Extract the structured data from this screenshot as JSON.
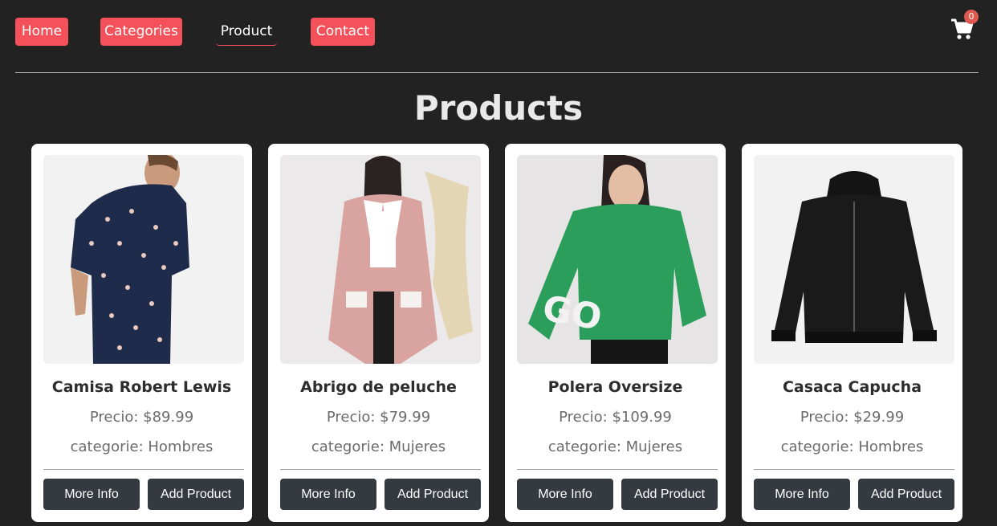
{
  "nav": {
    "home": "Home",
    "categories": "Categories",
    "product": "Product",
    "contact": "Contact"
  },
  "cart": {
    "count": "0",
    "icon": "shopping-cart-icon"
  },
  "page_title": "Products",
  "colors": {
    "accent": "#f4515a",
    "background": "#222222",
    "button": "#343a40",
    "card": "#ffffff"
  },
  "products": [
    {
      "name": "Camisa Robert Lewis",
      "price": "Precio: $89.99",
      "category": "categorie: Hombres",
      "more_info": "More Info",
      "add": "Add Product"
    },
    {
      "name": "Abrigo de peluche",
      "price": "Precio: $79.99",
      "category": "categorie: Mujeres",
      "more_info": "More Info",
      "add": "Add Product"
    },
    {
      "name": "Polera Oversize",
      "price": "Precio: $109.99",
      "category": "categorie: Mujeres",
      "more_info": "More Info",
      "add": "Add Product"
    },
    {
      "name": "Casaca Capucha",
      "price": "Precio: $29.99",
      "category": "categorie: Hombres",
      "more_info": "More Info",
      "add": "Add Product"
    }
  ]
}
